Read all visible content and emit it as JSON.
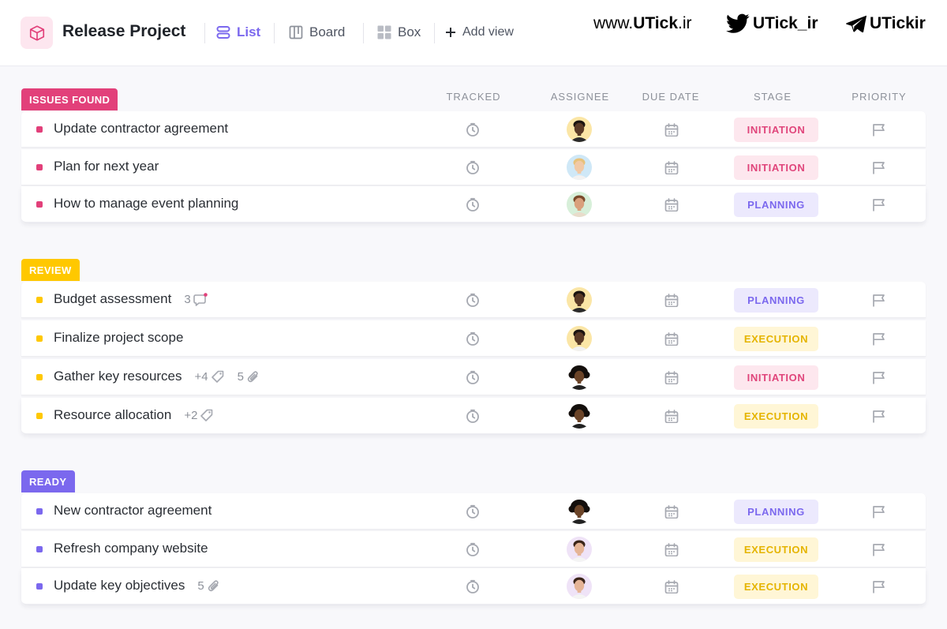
{
  "header": {
    "project_title": "Release Project",
    "project_icon": "cube-icon",
    "views": [
      {
        "label": "List",
        "icon": "list-icon",
        "active": true
      },
      {
        "label": "Board",
        "icon": "board-icon",
        "active": false
      },
      {
        "label": "Box",
        "icon": "box-grid-icon",
        "active": false
      }
    ],
    "add_view_label": "Add view",
    "brand": {
      "site": "www.UTick.ir",
      "site_prefix": "www.",
      "site_bold": "UTick",
      "site_suffix": ".ir",
      "twitter": "UTick_ir",
      "telegram": "UTickir"
    }
  },
  "columns": {
    "tracked": "TRACKED",
    "assignee": "ASSIGNEE",
    "due_date": "DUE DATE",
    "stage": "STAGE",
    "priority": "PRIORITY"
  },
  "colors": {
    "accent": "#7b68ee",
    "issues": "#e2407a",
    "review": "#ffc800",
    "ready": "#7b68ee"
  },
  "groups": [
    {
      "label": "ISSUES FOUND",
      "color": "#e2407a",
      "tasks": [
        {
          "name": "Update contractor agreement",
          "stage": "INITIATION"
        },
        {
          "name": "Plan for next year",
          "stage": "INITIATION"
        },
        {
          "name": "How to manage event planning",
          "stage": "PLANNING"
        }
      ]
    },
    {
      "label": "REVIEW",
      "color": "#ffc800",
      "tasks": [
        {
          "name": "Budget assessment",
          "stage": "PLANNING",
          "comments": "3"
        },
        {
          "name": "Finalize project scope",
          "stage": "EXECUTION"
        },
        {
          "name": "Gather key resources",
          "stage": "INITIATION",
          "tags": "+4",
          "attachments": "5"
        },
        {
          "name": "Resource allocation",
          "stage": "EXECUTION",
          "tags": "+2"
        }
      ]
    },
    {
      "label": "READY",
      "color": "#7b68ee",
      "tasks": [
        {
          "name": "New contractor agreement",
          "stage": "PLANNING"
        },
        {
          "name": "Refresh company website",
          "stage": "EXECUTION"
        },
        {
          "name": "Update key objectives",
          "stage": "EXECUTION",
          "attachments": "5"
        }
      ]
    }
  ]
}
